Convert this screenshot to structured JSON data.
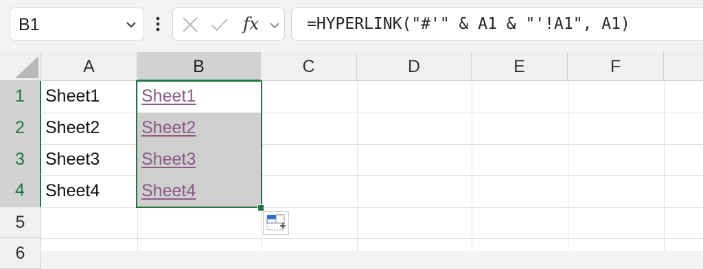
{
  "name_box": {
    "value": "B1"
  },
  "formula_bar": {
    "fx_label": "fx",
    "formula": "=HYPERLINK(\"#'\" & A1 & \"'!A1\", A1)"
  },
  "columns": [
    "A",
    "B",
    "C",
    "D",
    "E",
    "F"
  ],
  "selected_column": "B",
  "rows": [
    "1",
    "2",
    "3",
    "4",
    "5",
    "6"
  ],
  "selected_rows": [
    "1",
    "2",
    "3",
    "4"
  ],
  "cells": {
    "A1": "Sheet1",
    "A2": "Sheet2",
    "A3": "Sheet3",
    "A4": "Sheet4",
    "B1": "Sheet1",
    "B2": "Sheet2",
    "B3": "Sheet3",
    "B4": "Sheet4"
  },
  "selection": {
    "range": "B1:B4",
    "active_cell": "B1"
  },
  "colors": {
    "accent": "#217346",
    "hyperlink": "#8a5a85",
    "selected_header": "#d2d2d2"
  },
  "icons": {
    "name_box_dropdown": "chevron-down-icon",
    "more": "vertical-ellipsis-icon",
    "cancel": "x-icon",
    "enter": "check-icon",
    "insert_function": "fx-icon",
    "quick_analysis": "quick-analysis-icon"
  }
}
